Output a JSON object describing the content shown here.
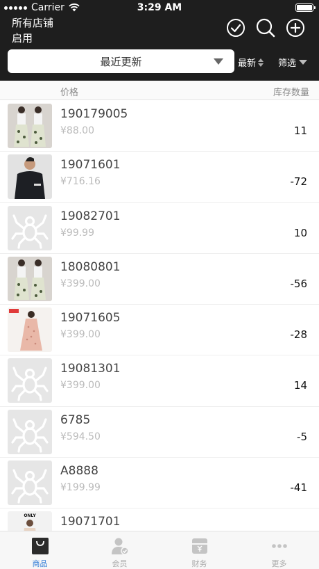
{
  "status": {
    "carrier": "Carrier",
    "time": "3:29 AM"
  },
  "header": {
    "store": "所有店铺",
    "state": "启用"
  },
  "toolbar": {
    "sort": "最近更新",
    "latest": "最新",
    "filter": "筛选"
  },
  "columns": {
    "price": "价格",
    "stock": "库存数量"
  },
  "products": [
    {
      "code": "190179005",
      "price": "¥88.00",
      "qty": "11",
      "thumb": "dress-photo"
    },
    {
      "code": "19071601",
      "price": "¥716.16",
      "qty": "-72",
      "thumb": "jacket-photo"
    },
    {
      "code": "19082701",
      "price": "¥99.99",
      "qty": "10",
      "thumb": "placeholder-spider"
    },
    {
      "code": "18080801",
      "price": "¥399.00",
      "qty": "-56",
      "thumb": "dress-photo"
    },
    {
      "code": "19071605",
      "price": "¥399.00",
      "qty": "-28",
      "thumb": "pink-dress-photo"
    },
    {
      "code": "19081301",
      "price": "¥399.00",
      "qty": "14",
      "thumb": "placeholder-spider"
    },
    {
      "code": "6785",
      "price": "¥594.50",
      "qty": "-5",
      "thumb": "placeholder-spider"
    },
    {
      "code": "A8888",
      "price": "¥199.99",
      "qty": "-41",
      "thumb": "placeholder-spider"
    },
    {
      "code": "19071701",
      "price": "",
      "qty": "",
      "thumb": "only-photo"
    }
  ],
  "tabs": [
    {
      "label": "商品",
      "icon": "bag-icon",
      "active": true
    },
    {
      "label": "会员",
      "icon": "member-icon",
      "active": false
    },
    {
      "label": "财务",
      "icon": "finance-icon",
      "active": false
    },
    {
      "label": "更多",
      "icon": "more-icon",
      "active": false
    }
  ],
  "colors": {
    "accent": "#2e7bd6",
    "header_bg": "#1e1e1e"
  }
}
